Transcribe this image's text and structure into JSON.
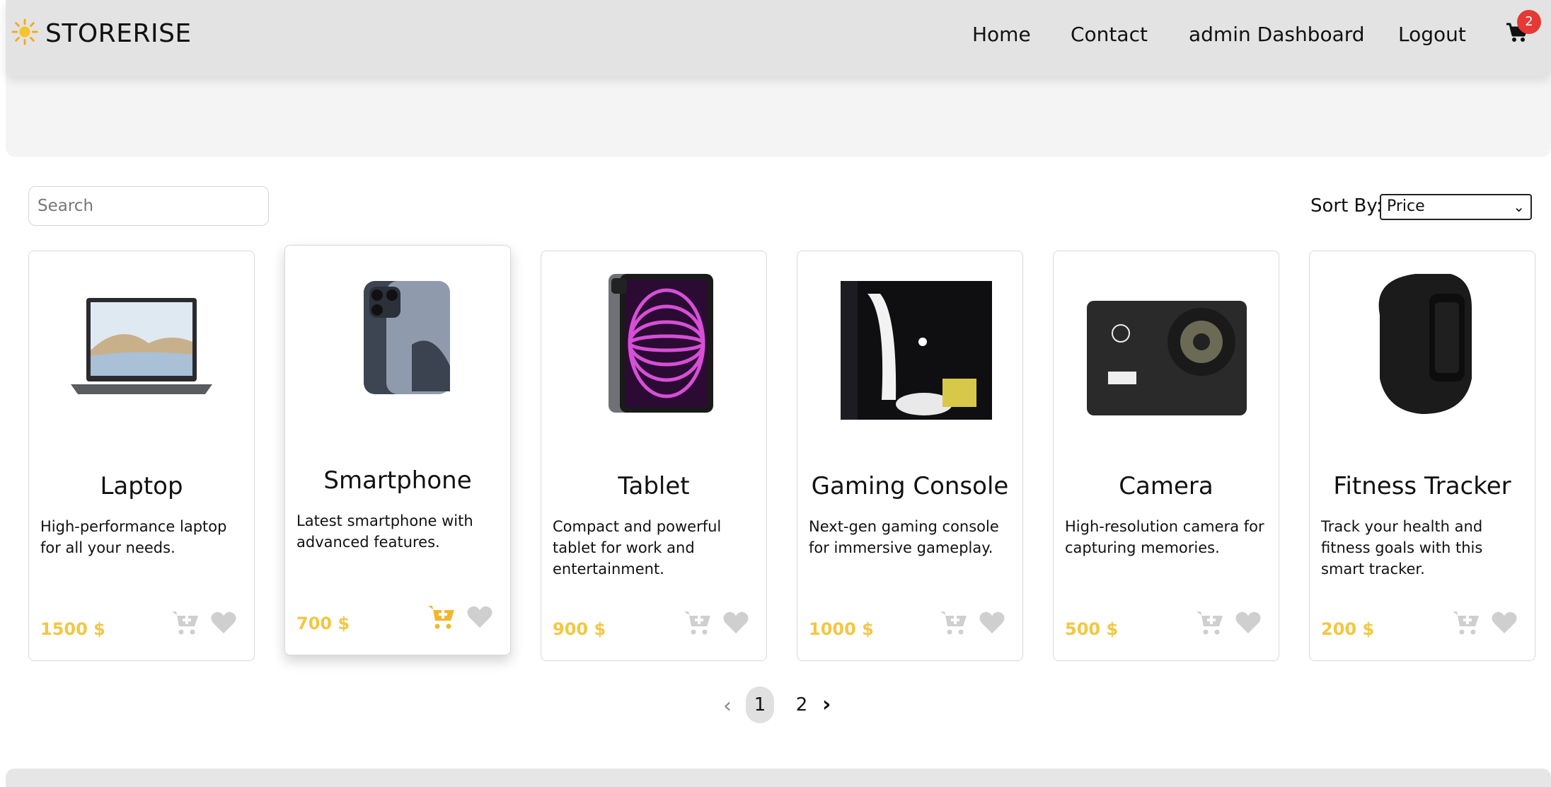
{
  "brand": {
    "name": "STORERISE",
    "logo_icon": "sun-icon"
  },
  "nav": {
    "links": [
      "Home",
      "Contact",
      "admin Dashboard",
      "Logout"
    ],
    "cart_icon": "cart-icon",
    "cart_count": "2"
  },
  "search": {
    "placeholder": "Search",
    "value": ""
  },
  "sort": {
    "label": "Sort By:",
    "selected": "Price"
  },
  "products": [
    {
      "name": "Laptop",
      "description": "High-performance laptop for all your needs.",
      "price": "1500 $",
      "image_icon": "laptop-image"
    },
    {
      "name": "Smartphone",
      "description": "Latest smartphone with advanced features.",
      "price": "700 $",
      "image_icon": "smartphone-image"
    },
    {
      "name": "Tablet",
      "description": "Compact and powerful tablet for work and entertainment.",
      "price": "900 $",
      "image_icon": "tablet-image"
    },
    {
      "name": "Gaming Console",
      "description": "Next-gen gaming console for immersive gameplay.",
      "price": "1000 $",
      "image_icon": "gaming-console-image"
    },
    {
      "name": "Camera",
      "description": "High-resolution camera for capturing memories.",
      "price": "500 $",
      "image_icon": "camera-image"
    },
    {
      "name": "Fitness Tracker",
      "description": "Track your health and fitness goals with this smart tracker.",
      "price": "200 $",
      "image_icon": "fitness-tracker-image"
    }
  ],
  "pagination": {
    "prev_icon": "chevron-left-icon",
    "pages": [
      "1",
      "2"
    ],
    "current": "1",
    "next_icon": "chevron-right-icon"
  },
  "colors": {
    "price": "#f2c744",
    "badge": "#e53935",
    "icon_idle": "#cfcfcf",
    "navbar": "#e3e3e3"
  }
}
